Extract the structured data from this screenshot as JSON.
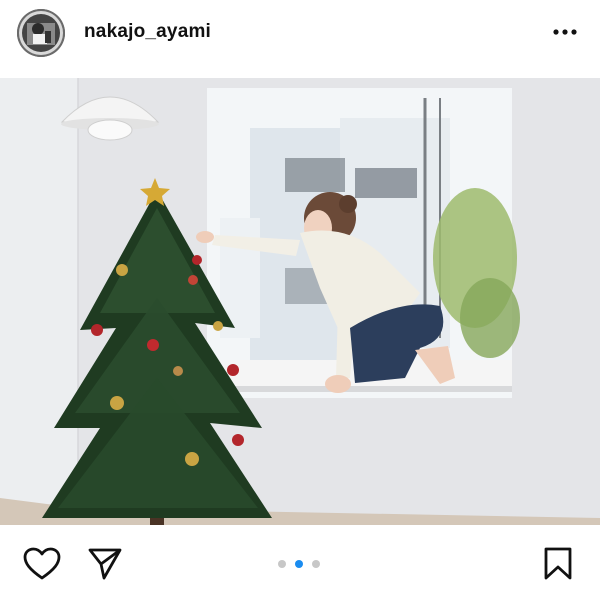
{
  "post": {
    "username": "nakajo_ayami"
  },
  "carousel": {
    "total": 3,
    "active_index": 1
  },
  "colors": {
    "active_dot": "#1a8cf0",
    "inactive_dot": "#c7c7c7"
  },
  "icons": {
    "more": "more-dots-icon",
    "like": "heart-icon",
    "share": "send-icon",
    "save": "bookmark-icon"
  }
}
